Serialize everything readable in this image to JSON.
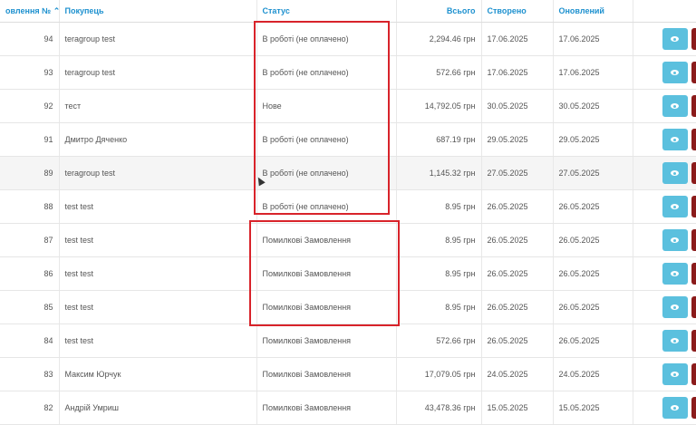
{
  "headers": {
    "order_no": "овлення №",
    "sort_arrow": "^",
    "customer": "Покупець",
    "status": "Статус",
    "total": "Всього",
    "created": "Створено",
    "updated": "Оновлений"
  },
  "rows": [
    {
      "id": "94",
      "customer": "teragroup test",
      "status": "В роботі (не оплачено)",
      "total": "2,294.46 грн",
      "created": "17.06.2025",
      "updated": "17.06.2025"
    },
    {
      "id": "93",
      "customer": "teragroup test",
      "status": "В роботі (не оплачено)",
      "total": "572.66 грн",
      "created": "17.06.2025",
      "updated": "17.06.2025"
    },
    {
      "id": "92",
      "customer": "тест",
      "status": "Нове",
      "total": "14,792.05 грн",
      "created": "30.05.2025",
      "updated": "30.05.2025"
    },
    {
      "id": "91",
      "customer": "Дмитро Дяченко",
      "status": "В роботі (не оплачено)",
      "total": "687.19 грн",
      "created": "29.05.2025",
      "updated": "29.05.2025"
    },
    {
      "id": "89",
      "customer": "teragroup test",
      "status": "В роботі (не оплачено)",
      "total": "1,145.32 грн",
      "created": "27.05.2025",
      "updated": "27.05.2025"
    },
    {
      "id": "88",
      "customer": "test test",
      "status": "В роботі (не оплачено)",
      "total": "8.95 грн",
      "created": "26.05.2025",
      "updated": "26.05.2025"
    },
    {
      "id": "87",
      "customer": "test test",
      "status": "Помилкові Замовлення",
      "total": "8.95 грн",
      "created": "26.05.2025",
      "updated": "26.05.2025"
    },
    {
      "id": "86",
      "customer": "test test",
      "status": "Помилкові Замовлення",
      "total": "8.95 грн",
      "created": "26.05.2025",
      "updated": "26.05.2025"
    },
    {
      "id": "85",
      "customer": "test test",
      "status": "Помилкові Замовлення",
      "total": "8.95 грн",
      "created": "26.05.2025",
      "updated": "26.05.2025"
    },
    {
      "id": "84",
      "customer": "test test",
      "status": "Помилкові Замовлення",
      "total": "572.66 грн",
      "created": "26.05.2025",
      "updated": "26.05.2025"
    },
    {
      "id": "83",
      "customer": "Максим Юрчук",
      "status": "Помилкові Замовлення",
      "total": "17,079.05 грн",
      "created": "24.05.2025",
      "updated": "24.05.2025"
    },
    {
      "id": "82",
      "customer": "Андрій Умриш",
      "status": "Помилкові Замовлення",
      "total": "43,478.36 грн",
      "created": "15.05.2025",
      "updated": "15.05.2025"
    }
  ],
  "icons": {
    "view": "eye-icon",
    "delete": "delete-icon"
  },
  "colors": {
    "header_text": "#1e91cf",
    "view_button": "#5bc0de",
    "delete_button": "#8b1b1b",
    "annotation_box": "#d8232a"
  }
}
